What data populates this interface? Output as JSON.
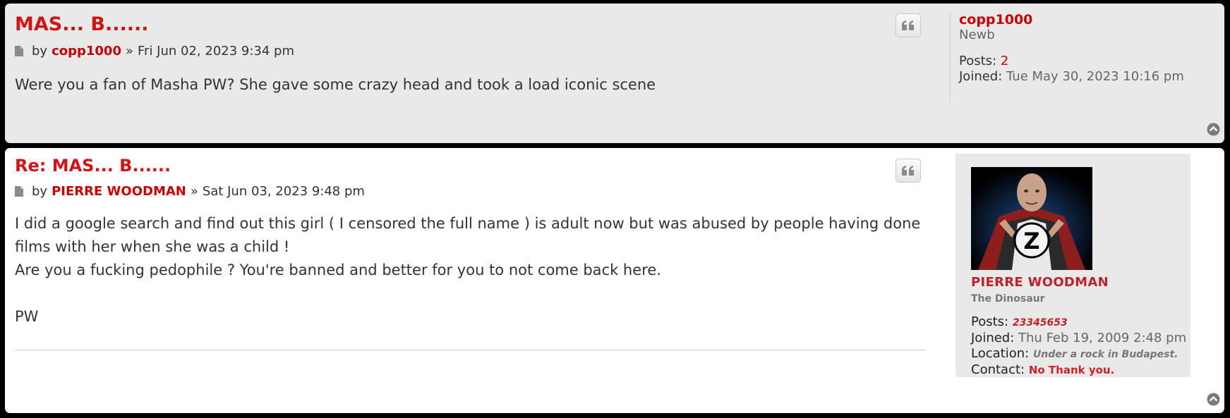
{
  "posts": [
    {
      "title": "MAS... B......",
      "by": "by",
      "author": "copp1000",
      "separator": "»",
      "date": "Fri Jun 02, 2023 9:34 pm",
      "content": [
        "Were you a fan of Masha PW? She gave some crazy head and took a load iconic scene"
      ],
      "profile": {
        "username": "copp1000",
        "rank": "Newb",
        "posts_label": "Posts:",
        "posts_value": "2",
        "joined_label": "Joined:",
        "joined_value": "Tue May 30, 2023 10:16 pm"
      }
    },
    {
      "title": "Re: MAS... B......",
      "by": "by",
      "author": "PIERRE WOODMAN",
      "separator": "»",
      "date": "Sat Jun 03, 2023 9:48 pm",
      "content": [
        "I did a google search and find out this girl ( I censored the full name ) is adult now but was abused by people having done",
        "films with her when she was a child !",
        "Are you a fucking pedophile ? You're banned and better for you to not come back here.",
        "",
        "PW"
      ],
      "profile": {
        "username": "PIERRE WOODMAN",
        "rank": "The Dinosaur",
        "posts_label": "Posts:",
        "posts_value": "23345653",
        "joined_label": "Joined:",
        "joined_value": "Thu Feb 19, 2009 2:48 pm",
        "location_label": "Location:",
        "location_value": "Under a rock in Budapest.",
        "contact_label": "Contact:",
        "contact_value": "No Thank you."
      }
    }
  ],
  "icons": {
    "post": "document-icon",
    "quote": "quote-icon",
    "top": "arrow-up-circle-icon",
    "avatar_letter": "Z"
  },
  "colors": {
    "accent_red": "#d31414",
    "post1_bg": "#e9e9e9",
    "post2_bg": "#ffffff"
  }
}
